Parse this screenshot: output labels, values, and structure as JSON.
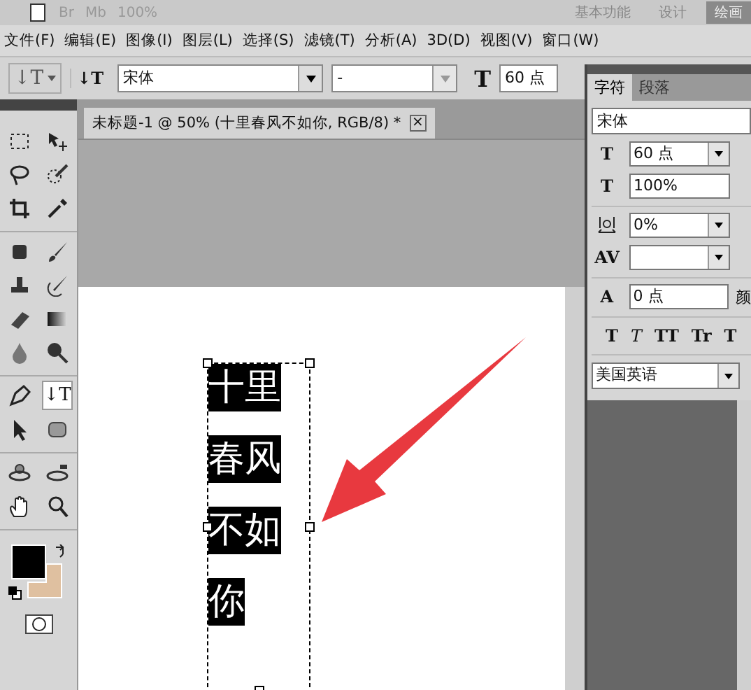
{
  "top_bar": {
    "items": [
      "Br",
      "Mb",
      "100%"
    ],
    "workspaces": [
      {
        "label": "基本功能",
        "selected": false
      },
      {
        "label": "设计",
        "selected": false
      },
      {
        "label": "绘画",
        "selected": true
      }
    ]
  },
  "menu": [
    "文件(F)",
    "编辑(E)",
    "图像(I)",
    "图层(L)",
    "选择(S)",
    "滤镜(T)",
    "分析(A)",
    "3D(D)",
    "视图(V)",
    "窗口(W)"
  ],
  "options_bar": {
    "tool_glyph": "↓T",
    "orientation_glyph": "↓T",
    "font_family": "宋体",
    "font_style": "-",
    "size_glyph": "T",
    "size": "60 点"
  },
  "document_tab": {
    "title": "未标题-1 @ 50% (十里春风不如你, RGB/8) *",
    "close": "×"
  },
  "toolbox": {
    "groups": [
      [
        {
          "kind": "marquee",
          "selected": false
        },
        {
          "kind": "move",
          "selected": false
        },
        {
          "kind": "lasso",
          "selected": false
        },
        {
          "kind": "quickselect",
          "selected": false
        },
        {
          "kind": "crop",
          "selected": false
        },
        {
          "kind": "eyedropper",
          "selected": false
        }
      ],
      [
        {
          "kind": "healing",
          "selected": false
        },
        {
          "kind": "brush",
          "selected": false
        },
        {
          "kind": "stamp",
          "selected": false
        },
        {
          "kind": "historybrush",
          "selected": false
        },
        {
          "kind": "eraser",
          "selected": false
        },
        {
          "kind": "gradient",
          "selected": false
        },
        {
          "kind": "blur",
          "selected": false
        },
        {
          "kind": "burn",
          "selected": false
        }
      ],
      [
        {
          "kind": "pen",
          "selected": false
        },
        {
          "kind": "type",
          "glyph": "↓T",
          "selected": true
        },
        {
          "kind": "pathselect",
          "selected": false
        },
        {
          "kind": "shape",
          "selected": false
        }
      ],
      [
        {
          "kind": "rotate3d",
          "selected": false
        },
        {
          "kind": "orbit3d",
          "selected": false
        },
        {
          "kind": "hand",
          "selected": false
        },
        {
          "kind": "zoom",
          "selected": false
        }
      ]
    ],
    "foreground": {
      "color": "#000000"
    },
    "background": {
      "color": "#dfc0a0"
    }
  },
  "canvas": {
    "text_lines": [
      "十里",
      "春风",
      "不如",
      "你"
    ]
  },
  "character_panel": {
    "tabs": [
      {
        "label": "字符",
        "selected": true
      },
      {
        "label": "段落",
        "selected": false
      }
    ],
    "font": "宋体",
    "fields": [
      {
        "kind": "size",
        "glyph": "T",
        "value": "60 点",
        "dropdown": true
      },
      {
        "kind": "leading",
        "glyph": "T",
        "value": "100%",
        "dropdown": false
      },
      {
        "kind": "tracking",
        "value": "0%",
        "dropdown": true
      },
      {
        "kind": "kerning",
        "glyph": "AV",
        "dropdown": true
      },
      {
        "kind": "baseline",
        "glyph": "A",
        "value": "0 点",
        "dropdown": false,
        "side_label": "颜"
      }
    ],
    "styles": [
      {
        "kind": "bold",
        "label": "T"
      },
      {
        "kind": "italic",
        "label": "T"
      },
      {
        "kind": "caps",
        "label": "TT"
      },
      {
        "kind": "smallcaps",
        "label": "Tr"
      },
      {
        "kind": "bold",
        "label": "T"
      }
    ],
    "language": "美国英语"
  }
}
